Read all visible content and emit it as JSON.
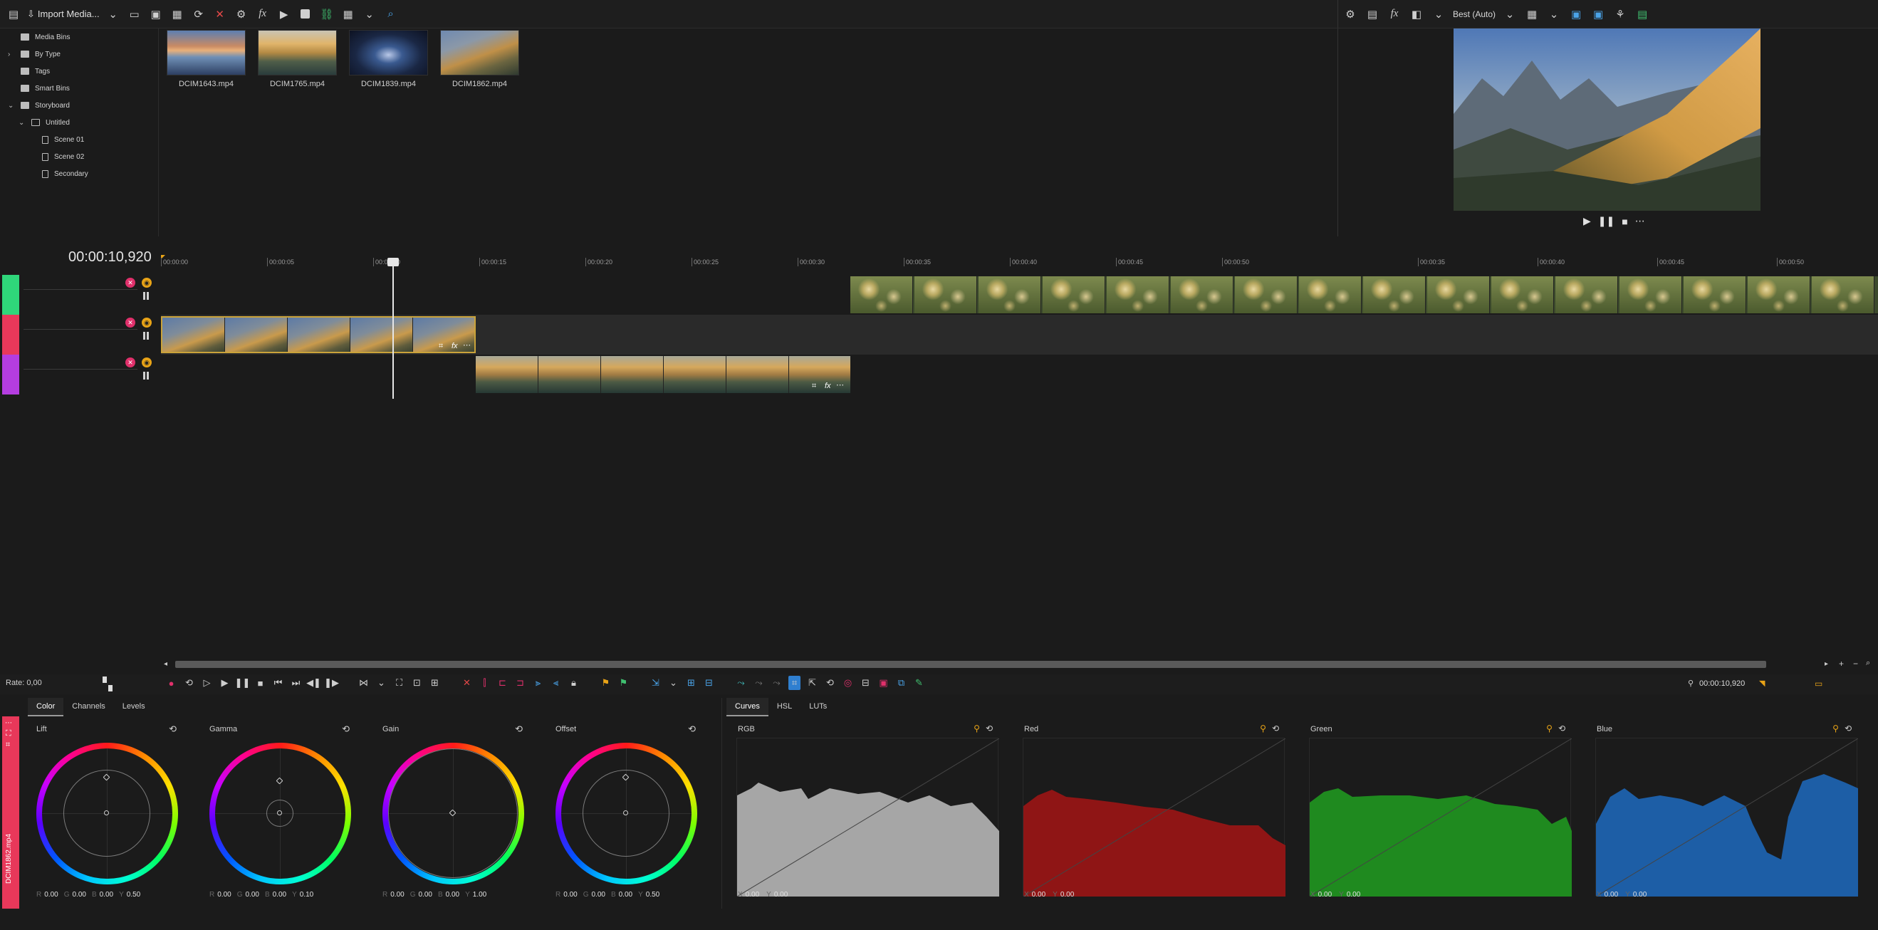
{
  "toolbar": {
    "import_label": "Import Media...",
    "icons": [
      "app-menu-icon",
      "import-icon",
      "dropdown-icon",
      "storyboard-icon",
      "media-icon",
      "scene-icon",
      "refresh-icon",
      "delete-icon",
      "settings-icon",
      "fx-icon",
      "play-icon",
      "stop-icon",
      "scene-link-icon",
      "grid-icon",
      "dropdown-icon",
      "search-icon"
    ]
  },
  "tree": {
    "items": [
      {
        "label": "Media Bins",
        "icon": "folder",
        "indent": 0,
        "caret": ""
      },
      {
        "label": "By Type",
        "icon": "folder",
        "indent": 0,
        "caret": "›"
      },
      {
        "label": "Tags",
        "icon": "folder",
        "indent": 0,
        "caret": ""
      },
      {
        "label": "Smart Bins",
        "icon": "folder",
        "indent": 0,
        "caret": ""
      },
      {
        "label": "Storyboard",
        "icon": "folder",
        "indent": 0,
        "caret": "⌄"
      },
      {
        "label": "Untitled",
        "icon": "folder-open",
        "indent": 1,
        "caret": "⌄"
      },
      {
        "label": "Scene 01",
        "icon": "file",
        "indent": 2,
        "caret": ""
      },
      {
        "label": "Scene 02",
        "icon": "file",
        "indent": 2,
        "caret": ""
      },
      {
        "label": "Secondary",
        "icon": "file",
        "indent": 2,
        "caret": ""
      }
    ]
  },
  "media": {
    "items": [
      {
        "name": "DCIM1643.mp4"
      },
      {
        "name": "DCIM1765.mp4"
      },
      {
        "name": "DCIM1839.mp4"
      },
      {
        "name": "DCIM1862.mp4"
      }
    ]
  },
  "viewer": {
    "quality_label": "Best (Auto)"
  },
  "timeline": {
    "timecode": "00:00:10,920",
    "ruler": [
      "00:00:00",
      "00:00:05",
      "00:00:10",
      "00:00:15",
      "00:00:20",
      "00:00:25",
      "00:00:30",
      "00:00:35",
      "00:00:40",
      "00:00:45",
      "00:00:50",
      "00:00:35",
      "00:00:40",
      "00:00:45",
      "00:00:50"
    ],
    "tracks": [
      {
        "color": "#2fd67a"
      },
      {
        "color": "#e8385a"
      },
      {
        "color": "#b43de0"
      }
    ]
  },
  "transport": {
    "rate_label": "Rate: 0,00",
    "timecode": "00:00:10,920"
  },
  "color_panel": {
    "tabs": [
      "Color",
      "Channels",
      "Levels"
    ],
    "active_tab": "Color",
    "side_label": "DCIM1862.mp4",
    "wheels": [
      {
        "title": "Lift",
        "r": "0.00",
        "g": "0.00",
        "b": "0.00",
        "y": "0.50"
      },
      {
        "title": "Gamma",
        "r": "0.00",
        "g": "0.00",
        "b": "0.00",
        "y": "0.10"
      },
      {
        "title": "Gain",
        "r": "0.00",
        "g": "0.00",
        "b": "0.00",
        "y": "1.00"
      },
      {
        "title": "Offset",
        "r": "0.00",
        "g": "0.00",
        "b": "0.00",
        "y": "0.50"
      }
    ]
  },
  "curves_panel": {
    "tabs": [
      "Curves",
      "HSL",
      "LUTs"
    ],
    "active_tab": "Curves",
    "curves": [
      {
        "title": "RGB",
        "color": "#a6a6a6",
        "x": "0.00",
        "y": "0.00"
      },
      {
        "title": "Red",
        "color": "#8f1515",
        "x": "0.00",
        "y": "0.00"
      },
      {
        "title": "Green",
        "color": "#1f8a1f",
        "x": "0.00",
        "y": "0.00"
      },
      {
        "title": "Blue",
        "color": "#1d5ea6",
        "x": "0.00",
        "y": "0.00"
      }
    ]
  }
}
